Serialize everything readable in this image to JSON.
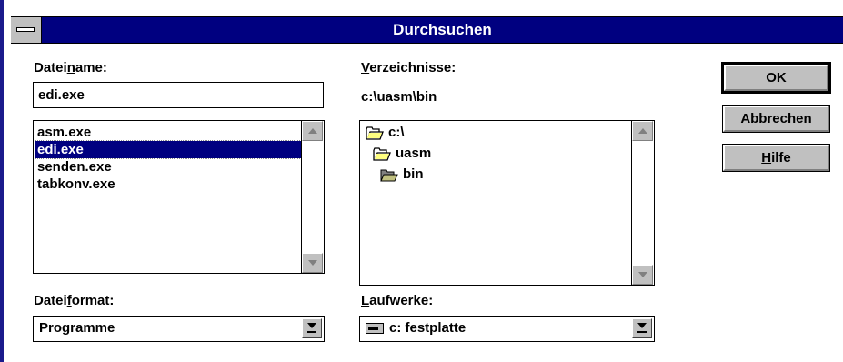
{
  "window": {
    "title": "Durchsuchen"
  },
  "filename": {
    "label_pre": "Datei",
    "label_acc": "n",
    "label_post": "ame:",
    "value": "edi.exe",
    "files": [
      "asm.exe",
      "edi.exe",
      "senden.exe",
      "tabkonv.exe"
    ],
    "selected": "edi.exe"
  },
  "directories": {
    "label_acc": "V",
    "label_post": "erzeichnisse:",
    "current_path": "c:\\uasm\\bin",
    "tree": [
      {
        "name": "c:\\",
        "icon": "open-folder-icon"
      },
      {
        "name": "uasm",
        "icon": "open-folder-icon"
      },
      {
        "name": "bin",
        "icon": "open-folder-shaded-icon"
      }
    ]
  },
  "fileformat": {
    "label_pre": "Datei",
    "label_acc": "f",
    "label_post": "ormat:",
    "value": "Programme"
  },
  "drives": {
    "label_acc": "L",
    "label_post": "aufwerke:",
    "value": "c: festplatte",
    "icon": "hard-drive-icon"
  },
  "buttons": {
    "ok": "OK",
    "cancel": "Abbrechen",
    "help_acc": "H",
    "help_rest": "ilfe"
  },
  "colors": {
    "titlebar": "#000080",
    "selection": "#000080",
    "button_face": "#c0c0c0"
  }
}
